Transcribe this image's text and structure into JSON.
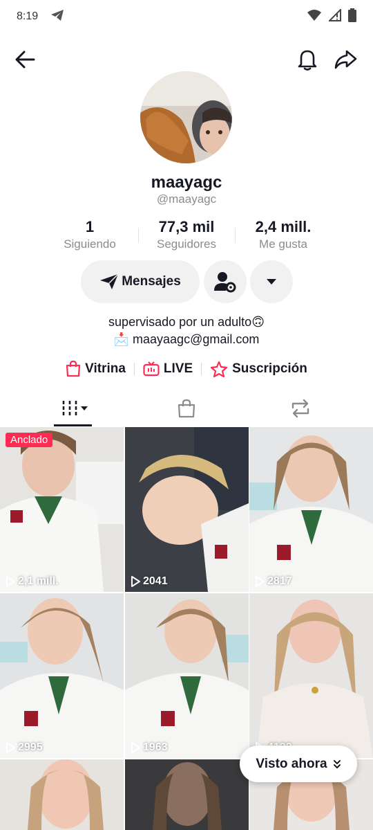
{
  "status_bar": {
    "time": "8:19"
  },
  "profile": {
    "display_name": "maayagc",
    "username": "@maayagc"
  },
  "stats": [
    {
      "value": "1",
      "label": "Siguiendo"
    },
    {
      "value": "77,3 mil",
      "label": "Seguidores"
    },
    {
      "value": "2,4 mill.",
      "label": "Me gusta"
    }
  ],
  "actions": {
    "message_label": "Mensajes"
  },
  "bio": {
    "line1": "supervisado por un adulto🙃",
    "line2": "📩 maayaagc@gmail.com"
  },
  "links": [
    {
      "label": "Vitrina",
      "icon": "shopping-bag-icon"
    },
    {
      "label": "LIVE",
      "icon": "live-tv-icon"
    },
    {
      "label": "Suscripción",
      "icon": "subscription-star-icon"
    }
  ],
  "tabs": [
    {
      "name": "videos",
      "icon": "grid-videos-icon"
    },
    {
      "name": "shop",
      "icon": "shopping-bag-icon"
    },
    {
      "name": "reposts",
      "icon": "repost-icon"
    }
  ],
  "videos": [
    {
      "views": "2,1 mill.",
      "pinned_label": "Anclado"
    },
    {
      "views": "2041"
    },
    {
      "views": "2817"
    },
    {
      "views": "2995"
    },
    {
      "views": "1963"
    },
    {
      "views": "4122"
    },
    {
      "views": ""
    },
    {
      "views": ""
    },
    {
      "views": ""
    }
  ],
  "watch_now": {
    "label": "Visto ahora"
  },
  "colors": {
    "accent": "#fe2c55",
    "text": "#161823",
    "muted": "#8a8b91",
    "button_bg": "#f1f1f2"
  }
}
